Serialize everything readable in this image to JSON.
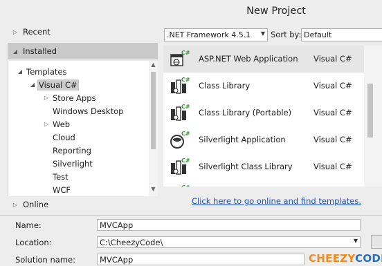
{
  "dialog": {
    "title": "New Project"
  },
  "left_pane": {
    "recent": "Recent",
    "installed": "Installed",
    "online": "Online",
    "tree": [
      {
        "label": "Templates",
        "expanded": true
      },
      {
        "label": "Visual C#",
        "expanded": true,
        "selected": true
      },
      {
        "label": "Store Apps",
        "collapsed": true
      },
      {
        "label": "Windows Desktop"
      },
      {
        "label": "Web",
        "collapsed": true
      },
      {
        "label": "Cloud"
      },
      {
        "label": "Reporting"
      },
      {
        "label": "Silverlight"
      },
      {
        "label": "Test"
      },
      {
        "label": "WCF"
      }
    ]
  },
  "toolbar": {
    "framework_value": ".NET Framework 4.5.1",
    "sort_label": "Sort by:",
    "sort_value": "Default"
  },
  "templates": [
    {
      "name": "ASP.NET Web Application",
      "lang": "Visual C#",
      "icon": "aspnet-web-app-icon",
      "selected": true
    },
    {
      "name": "Class Library",
      "lang": "Visual C#",
      "icon": "class-library-icon"
    },
    {
      "name": "Class Library (Portable)",
      "lang": "Visual C#",
      "icon": "portable-class-library-icon"
    },
    {
      "name": "Silverlight Application",
      "lang": "Visual C#",
      "icon": "silverlight-app-icon"
    },
    {
      "name": "Silverlight Class Library",
      "lang": "Visual C#",
      "icon": "silverlight-class-library-icon"
    }
  ],
  "online_link": "Click here to go online and find templates.",
  "form": {
    "name_label": "Name:",
    "name_value": "MVCApp",
    "location_label": "Location:",
    "location_value": "C:\\CheezyCode\\",
    "solution_label": "Solution name:",
    "solution_value": "MVCApp"
  },
  "watermark": {
    "part1": "CHEEZY",
    "part2": "CODE"
  },
  "colors": {
    "accent_link": "#1e4fb5",
    "csharp_green": "#3a9a3a",
    "watermark_orange": "#f08a1e",
    "watermark_blue": "#2a6fb6"
  }
}
